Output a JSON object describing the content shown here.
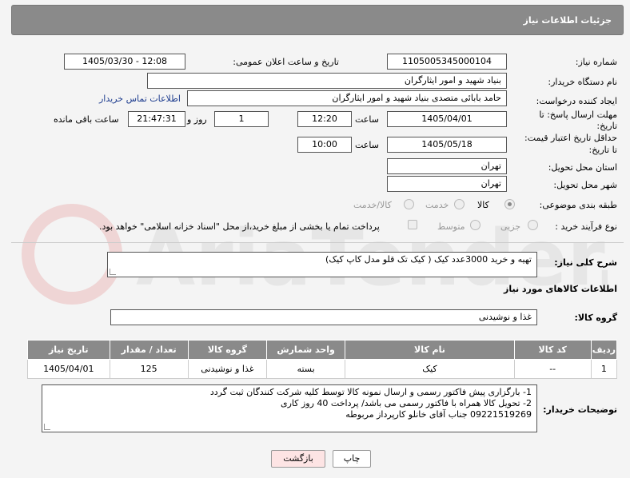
{
  "header": {
    "title": "جزئیات اطلاعات نیاز"
  },
  "form": {
    "need_number_label": "شماره نیاز:",
    "need_number": "1105005345000104",
    "announce_label": "تاریخ و ساعت اعلان عمومی:",
    "announce_value": "1405/03/30 - 12:08",
    "buyer_org_label": "نام دستگاه خریدار:",
    "buyer_org": "بنیاد شهید و امور ایثارگران",
    "creator_label": "ایجاد کننده درخواست:",
    "creator": "حامد بابائی متصدی بنیاد شهید و امور ایثارگران",
    "contact_link": "اطلاعات تماس خریدار",
    "reply_deadline_label_1": "مهلت ارسال پاسخ: تا",
    "reply_deadline_label_2": "تاریخ:",
    "reply_date": "1405/04/01",
    "time_label": "ساعت",
    "reply_time": "12:20",
    "days_value": "1",
    "days_label": "روز و",
    "remaining_time": "21:47:31",
    "remaining_label": "ساعت باقی مانده",
    "price_deadline_label_1": "حداقل تاریخ اعتبار قیمت:",
    "price_deadline_label_2": "تا تاریخ:",
    "price_date": "1405/05/18",
    "price_time": "10:00",
    "province_label": "استان محل تحویل:",
    "province": "تهران",
    "city_label": "شهر محل تحویل:",
    "city": "تهران",
    "category_label": "طبقه بندی موضوعی:",
    "category_options": [
      "کالا",
      "خدمت",
      "کالا/خدمت"
    ],
    "process_label": "نوع فرآیند خرید :",
    "process_options": [
      "جزیی",
      "متوسط"
    ],
    "payment_note": "پرداخت تمام یا بخشی از مبلغ خرید،از محل \"اسناد خزانه اسلامی\" خواهد بود."
  },
  "description": {
    "label": "شرح کلی نیاز:",
    "text": "تهیه و خرید 3000عدد کیک ( کیک تک قلو مدل کاپ کیک)"
  },
  "goods": {
    "section_title": "اطلاعات کالاهای مورد نیاز",
    "group_label": "گروه کالا:",
    "group_value": "غذا و نوشیدنی",
    "columns": [
      "ردیف",
      "کد کالا",
      "نام کالا",
      "واحد شمارش",
      "گروه کالا",
      "تعداد / مقدار",
      "تاریخ نیاز"
    ],
    "rows": [
      [
        "1",
        "--",
        "کیک",
        "بسته",
        "غذا و نوشیدنی",
        "125",
        "1405/04/01"
      ]
    ]
  },
  "notes": {
    "label": "توضیحات خریدار:",
    "lines": [
      "1- بارگزاری پیش فاکتور رسمی و ارسال نمونه کالا توسط کلیه شرکت کنندگان ثبت گردد",
      "2- تحویل کالا همراه با فاکتور رسمی می باشد/ پرداخت 40 روز کاری",
      "09221519269 جناب آقای خانلو کارپرداز مربوطه"
    ]
  },
  "buttons": {
    "print": "چاپ",
    "back": "بازگشت"
  },
  "watermark": {
    "text": "AriaTender.neT"
  }
}
